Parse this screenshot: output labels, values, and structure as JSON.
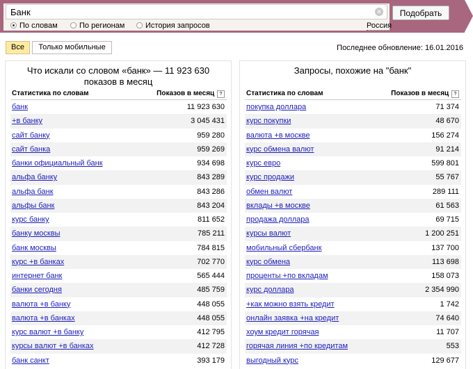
{
  "search": {
    "query": "Банк",
    "button": "Подобрать",
    "modes": [
      "По словам",
      "По регионам",
      "История запросов"
    ],
    "region": "Россия"
  },
  "filters": {
    "all": "Все",
    "mobile": "Только мобильные"
  },
  "updated": "Последнее обновление: 16.01.2016",
  "left": {
    "title_line1": "Что искали со словом «банк» — 11 923 630",
    "title_line2": "показов в месяц",
    "col_words": "Статистика по словам",
    "col_count": "Показов в месяц",
    "rows": [
      {
        "phrase": "банк",
        "count": "11 923 630"
      },
      {
        "phrase": "+в банку",
        "count": "3 045 431"
      },
      {
        "phrase": "сайт банку",
        "count": "959 280"
      },
      {
        "phrase": "сайт банка",
        "count": "959 269"
      },
      {
        "phrase": "банки официальный банк",
        "count": "934 698"
      },
      {
        "phrase": "альфа банку",
        "count": "843 289"
      },
      {
        "phrase": "альфа банк",
        "count": "843 286"
      },
      {
        "phrase": "альфы банк",
        "count": "843 204"
      },
      {
        "phrase": "курс банку",
        "count": "811 652"
      },
      {
        "phrase": "банку москвы",
        "count": "785 211"
      },
      {
        "phrase": "банк москвы",
        "count": "784 815"
      },
      {
        "phrase": "курс +в банках",
        "count": "702 770"
      },
      {
        "phrase": "интернет банк",
        "count": "565 444"
      },
      {
        "phrase": "банки сегодня",
        "count": "485 759"
      },
      {
        "phrase": "валюта +в банку",
        "count": "448 055"
      },
      {
        "phrase": "валюта +в банках",
        "count": "448 055"
      },
      {
        "phrase": "курс валют +в банку",
        "count": "412 795"
      },
      {
        "phrase": "курсы валют +в банках",
        "count": "412 728"
      },
      {
        "phrase": "банк санкт",
        "count": "393 179"
      }
    ]
  },
  "right": {
    "title": "Запросы, похожие на \"банк\"",
    "col_words": "Статистика по словам",
    "col_count": "Показов в месяц",
    "rows": [
      {
        "phrase": "покупка доллара",
        "count": "71 374"
      },
      {
        "phrase": "курс покупки",
        "count": "48 670"
      },
      {
        "phrase": "валюта +в москве",
        "count": "156 274"
      },
      {
        "phrase": "курс обмена валют",
        "count": "91 214"
      },
      {
        "phrase": "курс евро",
        "count": "599 801"
      },
      {
        "phrase": "курс продажи",
        "count": "55 767"
      },
      {
        "phrase": "обмен валют",
        "count": "289 111"
      },
      {
        "phrase": "вклады +в москве",
        "count": "61 563"
      },
      {
        "phrase": "продажа доллара",
        "count": "69 715"
      },
      {
        "phrase": "курсы валют",
        "count": "1 200 251"
      },
      {
        "phrase": "мобильный сбербанк",
        "count": "137 700"
      },
      {
        "phrase": "курс обмена",
        "count": "113 698"
      },
      {
        "phrase": "проценты +по вкладам",
        "count": "158 073"
      },
      {
        "phrase": "курс доллара",
        "count": "2 354 990"
      },
      {
        "phrase": "+как можно взять кредит",
        "count": "1 742"
      },
      {
        "phrase": "онлайн заявка +на кредит",
        "count": "74 640"
      },
      {
        "phrase": "хоум кредит горячая",
        "count": "11 707"
      },
      {
        "phrase": "горячая линия +по кредитам",
        "count": "553"
      },
      {
        "phrase": "выгодный курс",
        "count": "129 677"
      }
    ]
  },
  "colors": {
    "header_bar": "#a9667f",
    "active_filter": "#ffeba0",
    "link": "#1d1ebc",
    "row_stripe": "#f2f2f2"
  }
}
